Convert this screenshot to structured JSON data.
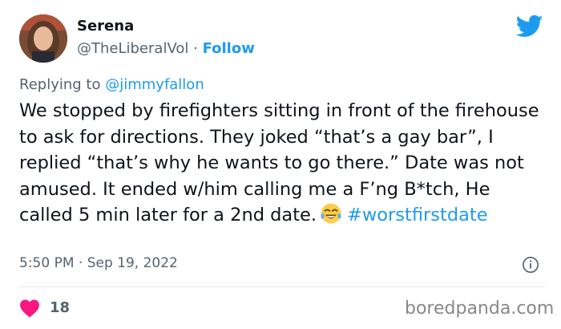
{
  "author": {
    "name": "Serena",
    "handle": "@TheLiberalVol",
    "separator": "·",
    "follow_label": "Follow"
  },
  "reply": {
    "prefix": "Replying to",
    "mention": "@jimmyfallon"
  },
  "tweet": {
    "text": "We stopped by firefighters sitting in front of the firehouse to ask for directions. They joked “that’s a gay bar”, I replied “that’s why he wants to go there.” Date was not amused. It ended w/him calling me a F’ng B*tch, He called 5 min later for a 2nd date.",
    "emoji": "face-with-tears-of-joy",
    "hashtag": "#worstfirstdate"
  },
  "meta": {
    "time": "5:50 PM",
    "separator": "·",
    "date": "Sep 19, 2022"
  },
  "engagement": {
    "likes": "18"
  },
  "watermark": "boredpanda.com",
  "colors": {
    "accent": "#1d9bf0",
    "heart": "#f91880",
    "secondary_text": "#536471"
  },
  "icons": {
    "brand": "twitter-bird-icon",
    "info": "info-icon",
    "like": "heart-icon"
  }
}
